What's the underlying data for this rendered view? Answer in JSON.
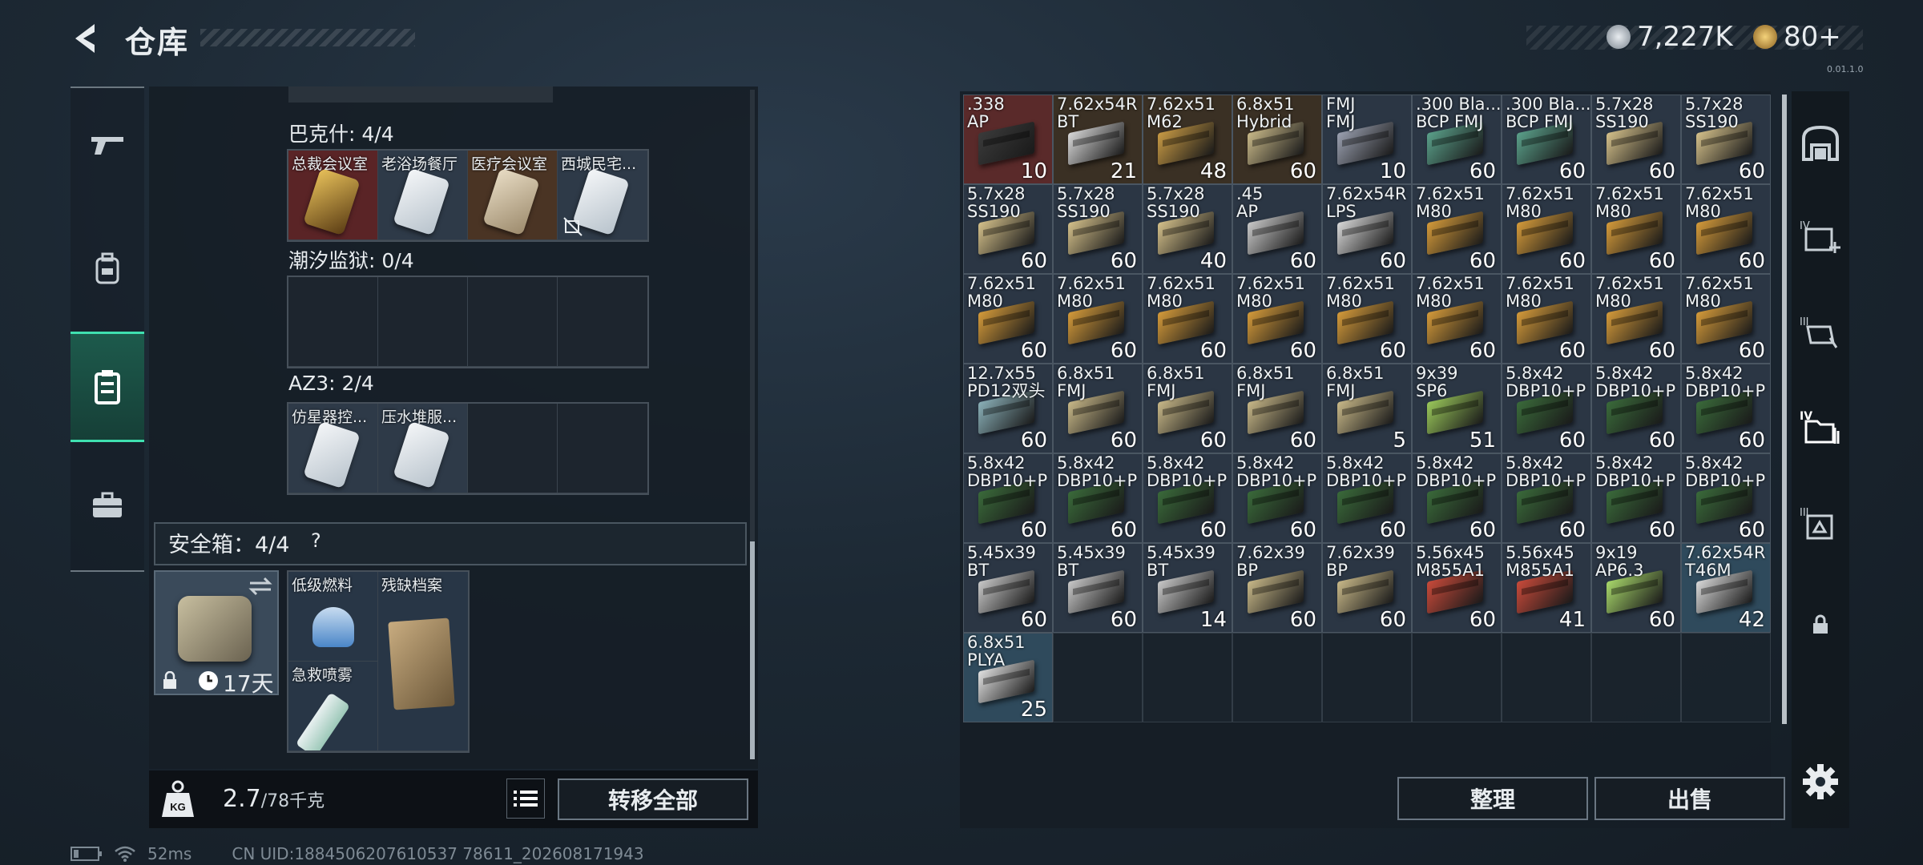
{
  "header": {
    "title": "仓库"
  },
  "currency": {
    "silver": "7,227K",
    "gold": "80+",
    "silver_color": "#b8c0c8",
    "gold_color": "#d9a84a"
  },
  "version": "0.01.1.0",
  "left_nav": [
    "gun-icon",
    "backpack-icon",
    "storage-icon",
    "toolbox-icon"
  ],
  "keys": {
    "group1": {
      "label": "巴克什: 4/4",
      "items": [
        "总裁会议室",
        "老浴场餐厅",
        "医疗会议室",
        "西城民宅..."
      ]
    },
    "group2": {
      "label": "潮汐监狱: 0/4"
    },
    "group3": {
      "label": "AZ3: 2/4",
      "items": [
        "仿星器控...",
        "压水堆服..."
      ]
    }
  },
  "safe": {
    "label": "安全箱：4/4",
    "help": "?",
    "days": "17天",
    "items": [
      "低级燃料",
      "残缺档案",
      "急救喷雾"
    ]
  },
  "weight": {
    "current": "2.7",
    "max": "/78千克"
  },
  "buttons": {
    "transfer_all": "转移全部",
    "sort": "整理",
    "sell": "出售"
  },
  "status": {
    "ping": "52ms",
    "uid": "CN UID:1884506207610537 78611_202608171943"
  },
  "inventory": [
    {
      "name": ".338\nAP",
      "count": "10",
      "color": "#3a3a3a",
      "bg": "#5a2a2a"
    },
    {
      "name": "7.62x54R\nBT",
      "count": "21",
      "color": "#d8d8d8",
      "bg": "#3a3024"
    },
    {
      "name": "7.62x51\nM62",
      "count": "48",
      "color": "#c89a44",
      "bg": "#3a3024"
    },
    {
      "name": "6.8x51\nHybrid",
      "count": "60",
      "color": "#c8b888",
      "bg": "#3a3024"
    },
    {
      "name": "FMJ\nFMJ",
      "count": "10",
      "color": "#9aa0b0",
      "bg": "#2b3644"
    },
    {
      "name": ".300 Bla...\nBCP FMJ",
      "count": "60",
      "color": "#5aa08a",
      "bg": "#2b3644"
    },
    {
      "name": ".300 Bla...\nBCP FMJ",
      "count": "60",
      "color": "#5aa08a",
      "bg": "#2b3644"
    },
    {
      "name": "5.7x28\nSS190",
      "count": "60",
      "color": "#d4c08a",
      "bg": "#2b3644"
    },
    {
      "name": "5.7x28\nSS190",
      "count": "60",
      "color": "#d4c08a",
      "bg": "#2b3644"
    },
    {
      "name": "5.7x28\nSS190",
      "count": "60",
      "color": "#d4c08a",
      "bg": "#2b3644"
    },
    {
      "name": "5.7x28\nSS190",
      "count": "60",
      "color": "#d4c08a",
      "bg": "#2b3644"
    },
    {
      "name": "5.7x28\nSS190",
      "count": "40",
      "color": "#d4c08a",
      "bg": "#2b3644"
    },
    {
      "name": ".45\nAP",
      "count": "60",
      "color": "#c8c8c8",
      "bg": "#2b3644"
    },
    {
      "name": "7.62x54R\nLPS",
      "count": "60",
      "color": "#d8d8d8",
      "bg": "#2b3644"
    },
    {
      "name": "7.62x51\nM80",
      "count": "60",
      "color": "#d49a3a",
      "bg": "#2b3644"
    },
    {
      "name": "7.62x51\nM80",
      "count": "60",
      "color": "#d49a3a",
      "bg": "#2b3644"
    },
    {
      "name": "7.62x51\nM80",
      "count": "60",
      "color": "#d49a3a",
      "bg": "#2b3644"
    },
    {
      "name": "7.62x51\nM80",
      "count": "60",
      "color": "#d49a3a",
      "bg": "#2b3644"
    },
    {
      "name": "7.62x51\nM80",
      "count": "60",
      "color": "#d49a3a",
      "bg": "#2b3644"
    },
    {
      "name": "7.62x51\nM80",
      "count": "60",
      "color": "#d49a3a",
      "bg": "#2b3644"
    },
    {
      "name": "7.62x51\nM80",
      "count": "60",
      "color": "#d49a3a",
      "bg": "#2b3644"
    },
    {
      "name": "7.62x51\nM80",
      "count": "60",
      "color": "#d49a3a",
      "bg": "#2b3644"
    },
    {
      "name": "7.62x51\nM80",
      "count": "60",
      "color": "#d49a3a",
      "bg": "#2b3644"
    },
    {
      "name": "7.62x51\nM80",
      "count": "60",
      "color": "#d49a3a",
      "bg": "#2b3644"
    },
    {
      "name": "7.62x51\nM80",
      "count": "60",
      "color": "#d49a3a",
      "bg": "#2b3644"
    },
    {
      "name": "7.62x51\nM80",
      "count": "60",
      "color": "#d49a3a",
      "bg": "#2b3644"
    },
    {
      "name": "7.62x51\nM80",
      "count": "60",
      "color": "#d49a3a",
      "bg": "#2b3644"
    },
    {
      "name": "12.7x55\nPD12双头",
      "count": "60",
      "color": "#8ab0b8",
      "bg": "#2b3644"
    },
    {
      "name": "6.8x51\nFMJ",
      "count": "60",
      "color": "#c8b888",
      "bg": "#2b3644"
    },
    {
      "name": "6.8x51\nFMJ",
      "count": "60",
      "color": "#c8b888",
      "bg": "#2b3644"
    },
    {
      "name": "6.8x51\nFMJ",
      "count": "60",
      "color": "#c8b888",
      "bg": "#2b3644"
    },
    {
      "name": "6.8x51\nFMJ",
      "count": "5",
      "color": "#c8b888",
      "bg": "#2b3644"
    },
    {
      "name": "9x39\nSP6",
      "count": "51",
      "color": "#9ac85a",
      "bg": "#2b3644"
    },
    {
      "name": "5.8x42\nDBP10+P",
      "count": "60",
      "color": "#3a6a3a",
      "bg": "#2b3644"
    },
    {
      "name": "5.8x42\nDBP10+P",
      "count": "60",
      "color": "#3a6a3a",
      "bg": "#2b3644"
    },
    {
      "name": "5.8x42\nDBP10+P",
      "count": "60",
      "color": "#3a6a3a",
      "bg": "#2b3644"
    },
    {
      "name": "5.8x42\nDBP10+P",
      "count": "60",
      "color": "#3a6a3a",
      "bg": "#2b3644"
    },
    {
      "name": "5.8x42\nDBP10+P",
      "count": "60",
      "color": "#3a6a3a",
      "bg": "#2b3644"
    },
    {
      "name": "5.8x42\nDBP10+P",
      "count": "60",
      "color": "#3a6a3a",
      "bg": "#2b3644"
    },
    {
      "name": "5.8x42\nDBP10+P",
      "count": "60",
      "color": "#3a6a3a",
      "bg": "#2b3644"
    },
    {
      "name": "5.8x42\nDBP10+P",
      "count": "60",
      "color": "#3a6a3a",
      "bg": "#2b3644"
    },
    {
      "name": "5.8x42\nDBP10+P",
      "count": "60",
      "color": "#3a6a3a",
      "bg": "#2b3644"
    },
    {
      "name": "5.8x42\nDBP10+P",
      "count": "60",
      "color": "#3a6a3a",
      "bg": "#2b3644"
    },
    {
      "name": "5.8x42\nDBP10+P",
      "count": "60",
      "color": "#3a6a3a",
      "bg": "#2b3644"
    },
    {
      "name": "5.8x42\nDBP10+P",
      "count": "60",
      "color": "#3a6a3a",
      "bg": "#2b3644"
    },
    {
      "name": "5.45x39\nBT",
      "count": "60",
      "color": "#c8c8c8",
      "bg": "#2b3644"
    },
    {
      "name": "5.45x39\nBT",
      "count": "60",
      "color": "#c8c8c8",
      "bg": "#2b3644"
    },
    {
      "name": "5.45x39\nBT",
      "count": "14",
      "color": "#c8c8c8",
      "bg": "#2b3644"
    },
    {
      "name": "7.62x39\nBP",
      "count": "60",
      "color": "#c8b888",
      "bg": "#2b3644"
    },
    {
      "name": "7.62x39\nBP",
      "count": "60",
      "color": "#c8b888",
      "bg": "#2b3644"
    },
    {
      "name": "5.56x45\nM855A1",
      "count": "60",
      "color": "#c84a3a",
      "bg": "#2b3644"
    },
    {
      "name": "5.56x45\nM855A1",
      "count": "41",
      "color": "#c84a3a",
      "bg": "#2b3644"
    },
    {
      "name": "9x19\nAP6.3",
      "count": "60",
      "color": "#a8d86a",
      "bg": "#2b3644"
    },
    {
      "name": "7.62x54R\nT46M",
      "count": "42",
      "color": "#d8d8d8",
      "bg": "#2f4a5c"
    },
    {
      "name": "6.8x51\nPLYA",
      "count": "25",
      "color": "#e0e0e0",
      "bg": "#2f4a5c"
    }
  ]
}
